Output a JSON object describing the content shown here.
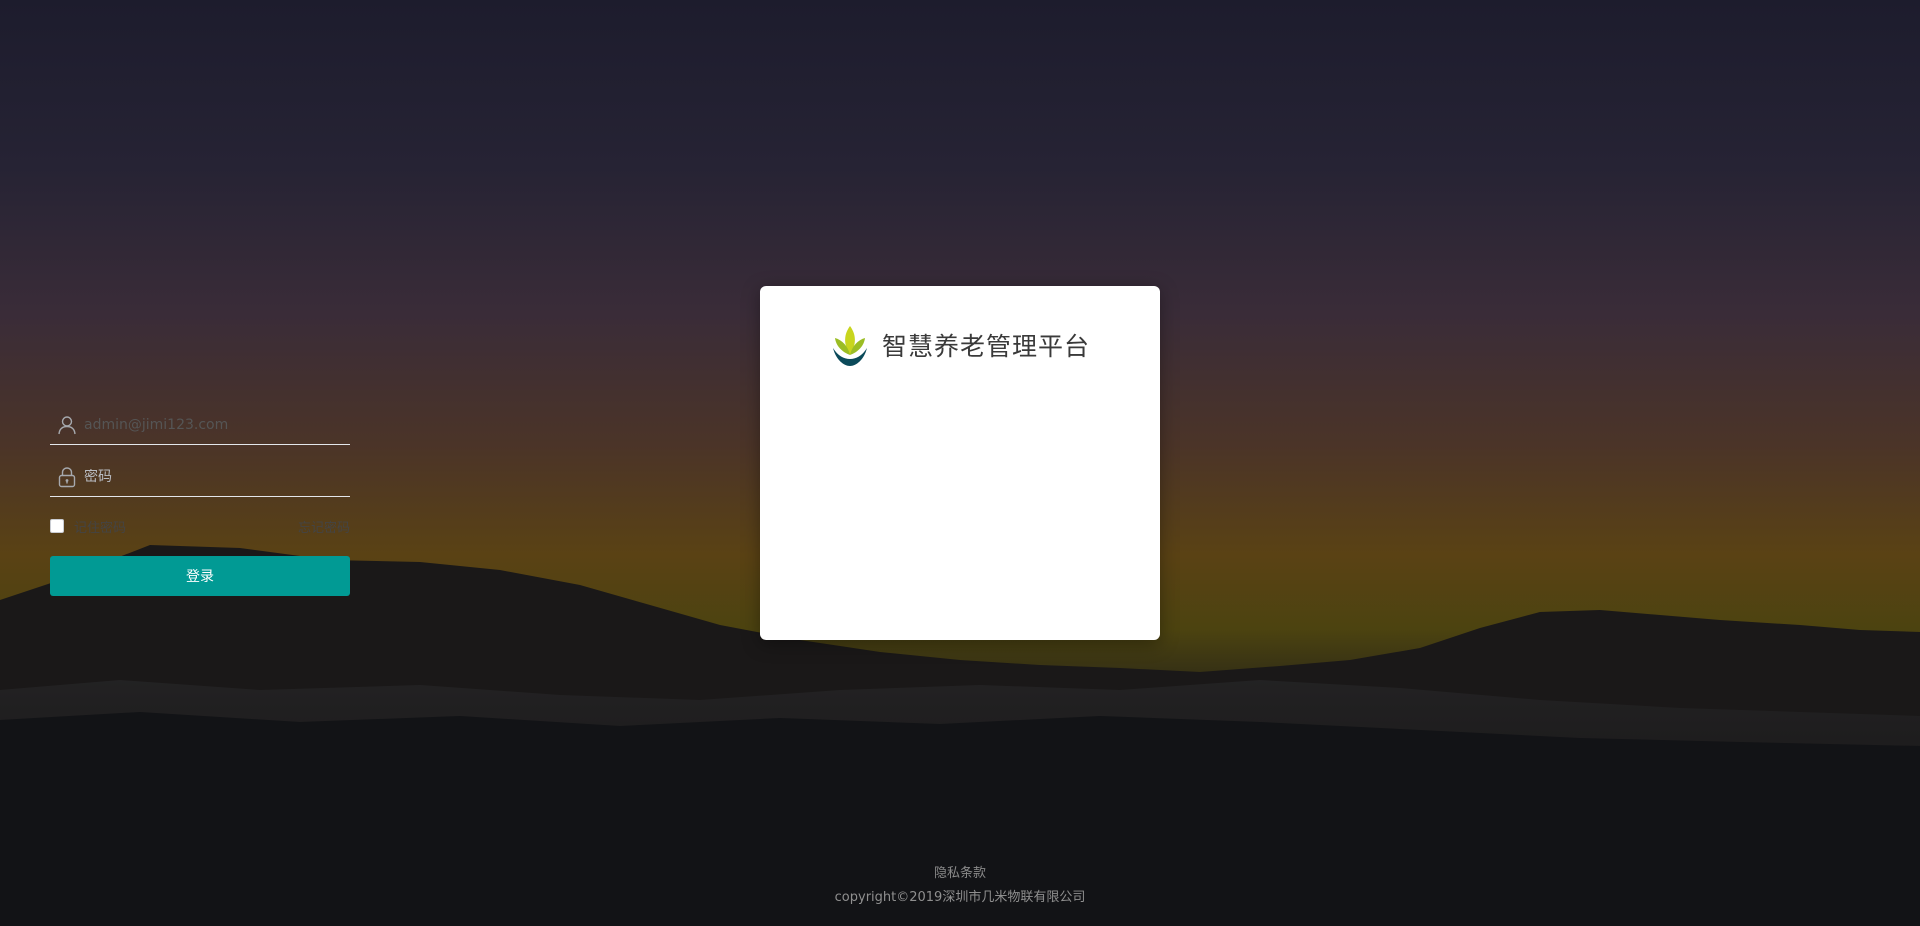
{
  "background": {
    "description_colors": {
      "sky_top": "#1d1c2d",
      "horizon_glow": "#5a4214",
      "ground": "#0d0f12"
    }
  },
  "login": {
    "title": "智慧养老管理平台",
    "logo_icon": "sprout-leaf-logo-icon",
    "username": {
      "value": "admin@jimi123.com",
      "placeholder": "",
      "icon": "user-icon"
    },
    "password": {
      "value": "",
      "placeholder": "密码",
      "icon": "lock-icon"
    },
    "remember_label": "记住密码",
    "remember_checked": false,
    "forgot_label": "忘记密码",
    "submit_label": "登录",
    "accent_color": "#019a94"
  },
  "footer": {
    "privacy_label": "隐私条款",
    "copyright": "copyright©2019深圳市几米物联有限公司"
  }
}
